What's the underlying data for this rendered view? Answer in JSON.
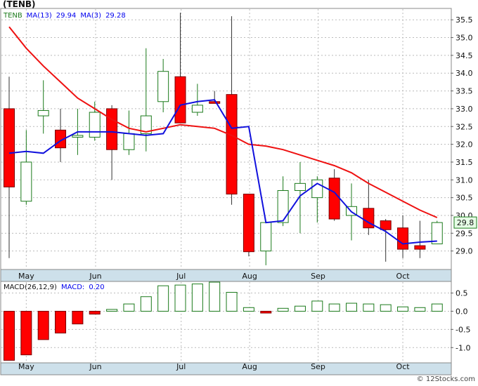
{
  "header": {
    "title": "(TENB)"
  },
  "chart_data": [
    {
      "type": "candlestick",
      "ticker": "TENB",
      "legend": [
        {
          "text": "TENB",
          "color": "#1b7a1b"
        },
        {
          "text": "MA(13)",
          "color": "#0000ee"
        },
        {
          "text": "29.94",
          "color": "#0000ee"
        },
        {
          "text": "MA(3)",
          "color": "#0000ee"
        },
        {
          "text": "29.28",
          "color": "#0000ee"
        }
      ],
      "last_price_label": "29.8",
      "last_price": 29.8,
      "ylim": [
        28.5,
        35.8
      ],
      "y_ticks": [
        "29.0",
        "29.5",
        "30.0",
        "30.5",
        "31.0",
        "31.5",
        "32.0",
        "32.5",
        "33.0",
        "33.5",
        "34.0",
        "34.5",
        "35.0",
        "35.5"
      ],
      "x_ticks": [
        "May",
        "Jun",
        "Jul",
        "Aug",
        "Sep",
        "Oct"
      ],
      "grid": true,
      "colors": {
        "up_fill": "#ffffff",
        "up_stroke": "#1b7a1b",
        "down_fill": "#ff0000",
        "down_stroke": "#7a0000",
        "ma_long": "#ee1111",
        "ma_short": "#1111dd",
        "axis_bar": "#cde0ea"
      },
      "candles": [
        {
          "o": 33.0,
          "h": 33.9,
          "l": 28.8,
          "c": 30.8
        },
        {
          "o": 30.4,
          "h": 32.4,
          "l": 30.3,
          "c": 31.5
        },
        {
          "o": 32.8,
          "h": 33.8,
          "l": 32.3,
          "c": 32.95
        },
        {
          "o": 32.4,
          "h": 33.0,
          "l": 31.5,
          "c": 31.9
        },
        {
          "o": 32.2,
          "h": 33.0,
          "l": 31.7,
          "c": 32.25
        },
        {
          "o": 32.2,
          "h": 33.2,
          "l": 32.1,
          "c": 32.9
        },
        {
          "o": 33.0,
          "h": 33.1,
          "l": 31.0,
          "c": 31.85
        },
        {
          "o": 31.85,
          "h": 32.95,
          "l": 31.7,
          "c": 32.3
        },
        {
          "o": 32.3,
          "h": 34.7,
          "l": 31.8,
          "c": 32.8
        },
        {
          "o": 33.2,
          "h": 34.4,
          "l": 32.9,
          "c": 34.05
        },
        {
          "o": 33.9,
          "h": 35.7,
          "l": 32.6,
          "c": 32.6
        },
        {
          "o": 32.9,
          "h": 33.7,
          "l": 32.8,
          "c": 33.1
        },
        {
          "o": 33.2,
          "h": 33.5,
          "l": 33.15,
          "c": 33.15
        },
        {
          "o": 33.4,
          "h": 35.6,
          "l": 30.3,
          "c": 30.6
        },
        {
          "o": 30.6,
          "h": 30.6,
          "l": 28.85,
          "c": 28.98
        },
        {
          "o": 29.0,
          "h": 29.8,
          "l": 28.6,
          "c": 29.8
        },
        {
          "o": 29.8,
          "h": 31.1,
          "l": 29.7,
          "c": 30.7
        },
        {
          "o": 30.7,
          "h": 31.5,
          "l": 29.5,
          "c": 30.9
        },
        {
          "o": 30.5,
          "h": 31.1,
          "l": 29.8,
          "c": 31.0
        },
        {
          "o": 31.05,
          "h": 31.3,
          "l": 29.85,
          "c": 29.9
        },
        {
          "o": 30.0,
          "h": 30.9,
          "l": 29.3,
          "c": 30.25
        },
        {
          "o": 30.2,
          "h": 31.0,
          "l": 29.45,
          "c": 29.65
        },
        {
          "o": 29.85,
          "h": 29.9,
          "l": 28.7,
          "c": 29.6
        },
        {
          "o": 29.65,
          "h": 30.0,
          "l": 28.8,
          "c": 29.05
        },
        {
          "o": 29.15,
          "h": 29.85,
          "l": 28.8,
          "c": 29.05
        },
        {
          "o": 29.2,
          "h": 29.85,
          "l": 29.2,
          "c": 29.8
        }
      ],
      "ma13": [
        35.3,
        34.7,
        34.2,
        33.75,
        33.3,
        33.0,
        32.7,
        32.45,
        32.35,
        32.45,
        32.55,
        32.5,
        32.45,
        32.25,
        32.0,
        31.95,
        31.85,
        31.7,
        31.55,
        31.4,
        31.2,
        30.9,
        30.65,
        30.4,
        30.15,
        29.94
      ],
      "ma3": [
        31.75,
        31.8,
        31.75,
        32.1,
        32.35,
        32.35,
        32.35,
        32.3,
        32.25,
        32.3,
        33.1,
        33.2,
        33.25,
        32.45,
        32.5,
        29.8,
        29.85,
        30.55,
        30.9,
        30.65,
        30.1,
        29.8,
        29.55,
        29.2,
        29.25,
        29.28
      ],
      "ma3_start_index": 0
    },
    {
      "type": "bar",
      "name": "MACD",
      "legend": [
        {
          "text": "MACD(26,12,9)",
          "color": "#111111"
        },
        {
          "text": "MACD:",
          "color": "#0000ee"
        },
        {
          "text": "0.20",
          "color": "#0000ee"
        }
      ],
      "ylim": [
        -1.4,
        0.8
      ],
      "y_ticks": [
        "0.5",
        "0.0",
        "-0.5",
        "-1.0"
      ],
      "x_ticks": [
        "May",
        "Jun",
        "Jul",
        "Aug",
        "Sep",
        "Oct"
      ],
      "values": [
        -1.35,
        -1.2,
        -0.78,
        -0.6,
        -0.35,
        -0.08,
        0.05,
        0.2,
        0.4,
        0.7,
        0.72,
        0.75,
        0.8,
        0.52,
        0.1,
        -0.05,
        0.08,
        0.14,
        0.28,
        0.2,
        0.22,
        0.2,
        0.18,
        0.12,
        0.1,
        0.2
      ],
      "colors": {
        "pos_stroke": "#1b7a1b",
        "pos_fill": "#ffffff",
        "neg_fill": "#ff0000",
        "neg_stroke": "#7a0000"
      }
    }
  ],
  "footer": {
    "watermark": "© 12Stocks.com"
  }
}
